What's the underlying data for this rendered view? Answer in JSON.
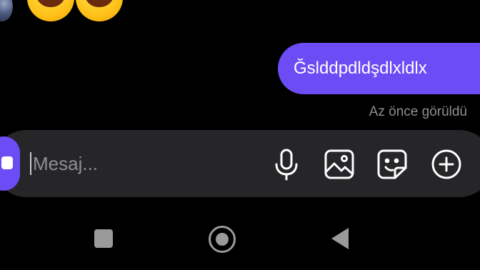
{
  "conversation": {
    "received_emojis": [
      {
        "icon": "grinning-squinting-face-emoji"
      },
      {
        "icon": "grinning-squinting-face-emoji"
      }
    ],
    "sent_message": {
      "text": "Ğslddpdldşdlxldlx"
    },
    "seen_status": "Az önce görüldü"
  },
  "composer": {
    "placeholder": "Mesaj...",
    "value": "",
    "buttons": [
      {
        "icon": "camera-icon"
      },
      {
        "icon": "microphone-icon"
      },
      {
        "icon": "image-icon"
      },
      {
        "icon": "sticker-icon"
      },
      {
        "icon": "plus-circle-icon"
      }
    ]
  },
  "system_nav": {
    "buttons": [
      {
        "icon": "recents-square-icon"
      },
      {
        "icon": "home-circle-icon"
      },
      {
        "icon": "back-triangle-icon"
      }
    ]
  },
  "colors": {
    "background": "#000000",
    "accent": "#6c4cf5",
    "composer_bg": "#262629",
    "muted_text": "#8e8e93",
    "nav_gray": "#9a9a9a"
  }
}
